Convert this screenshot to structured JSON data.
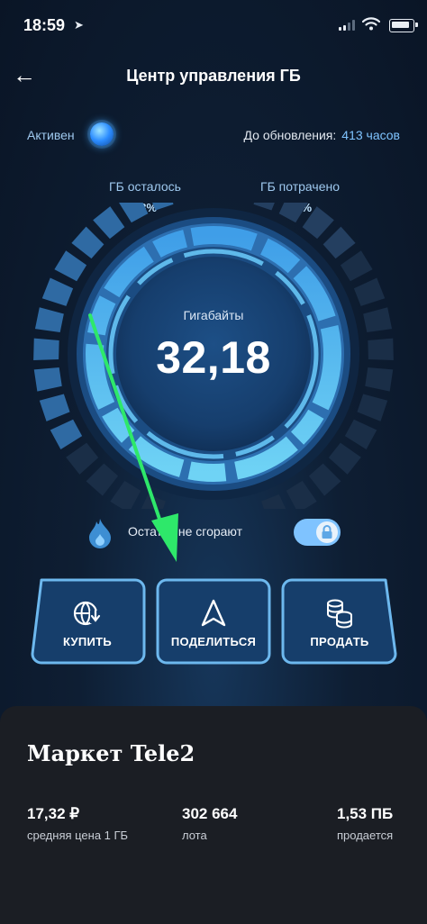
{
  "status_bar": {
    "time": "18:59",
    "location_glyph": "➤"
  },
  "header": {
    "title": "Центр управления ГБ",
    "back_glyph": "←"
  },
  "status": {
    "state": "Активен",
    "update_label": "До обновления:",
    "update_value": "413 часов"
  },
  "gauge": {
    "left_label": "ГБ осталось",
    "left_percent": "73%",
    "right_label": "ГБ потрачено",
    "right_percent": "27%",
    "unit": "Гигабайты",
    "value": "32,18",
    "remaining_fraction": 0.73
  },
  "burn": {
    "text": "Остатки не сгорают",
    "toggle_on": true
  },
  "actions": [
    {
      "label": "КУПИТЬ",
      "icon": "globe-download-icon"
    },
    {
      "label": "ПОДЕЛИТЬСЯ",
      "icon": "share-arrow-icon"
    },
    {
      "label": "ПРОДАТЬ",
      "icon": "coins-icon"
    }
  ],
  "market": {
    "title": "Маркет Tele2",
    "stats": [
      {
        "value": "17,32 ₽",
        "sub": "средняя цена 1 ГБ"
      },
      {
        "value": "302 664",
        "sub": "лота"
      },
      {
        "value": "1,53 ПБ",
        "sub": "продается"
      }
    ]
  },
  "colors": {
    "accent": "#7fc4ff",
    "background": "#0e1e33",
    "market_bg": "#1b1e24",
    "annotation_arrow": "#2ee86a"
  }
}
